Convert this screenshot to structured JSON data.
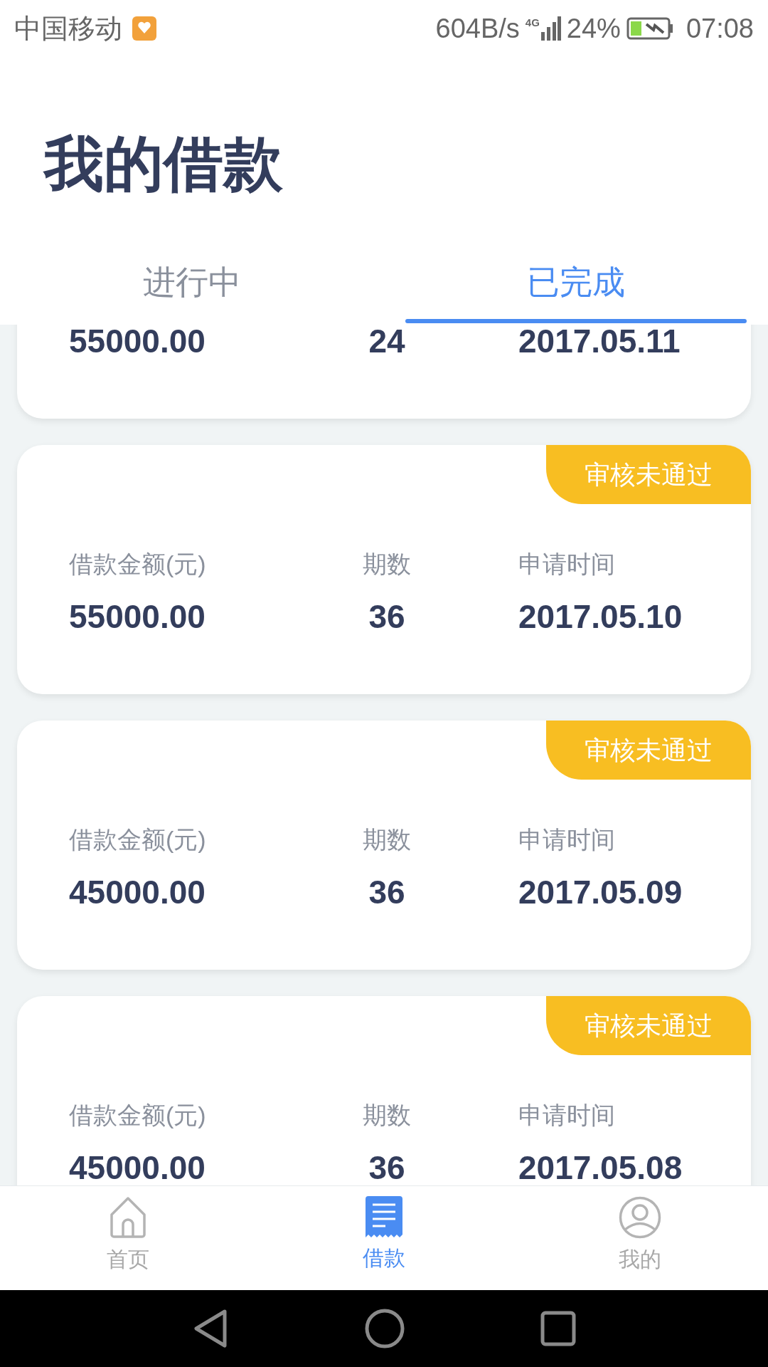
{
  "status_bar": {
    "carrier": "中国移动",
    "speed": "604B/s",
    "network": "4G",
    "battery": "24%",
    "time": "07:08"
  },
  "title": "我的借款",
  "tabs": [
    {
      "label": "进行中",
      "selected": false
    },
    {
      "label": "已完成",
      "selected": true
    }
  ],
  "loans": [
    {
      "amount": "55000.00",
      "periods": "24",
      "date": "2017.05.11"
    },
    {
      "status": "审核未通过",
      "amount_label": "借款金额(元)",
      "periods_label": "期数",
      "date_label": "申请时间",
      "amount": "55000.00",
      "periods": "36",
      "date": "2017.05.10"
    },
    {
      "status": "审核未通过",
      "amount_label": "借款金额(元)",
      "periods_label": "期数",
      "date_label": "申请时间",
      "amount": "45000.00",
      "periods": "36",
      "date": "2017.05.09"
    },
    {
      "status": "审核未通过",
      "amount_label": "借款金额(元)",
      "periods_label": "期数",
      "date_label": "申请时间",
      "amount": "45000.00",
      "periods": "36",
      "date": "2017.05.08"
    }
  ],
  "nav": [
    {
      "kind": "home",
      "label": "首页",
      "selected": false
    },
    {
      "kind": "loan",
      "label": "借款",
      "selected": true
    },
    {
      "kind": "me",
      "label": "我的",
      "selected": false
    }
  ]
}
